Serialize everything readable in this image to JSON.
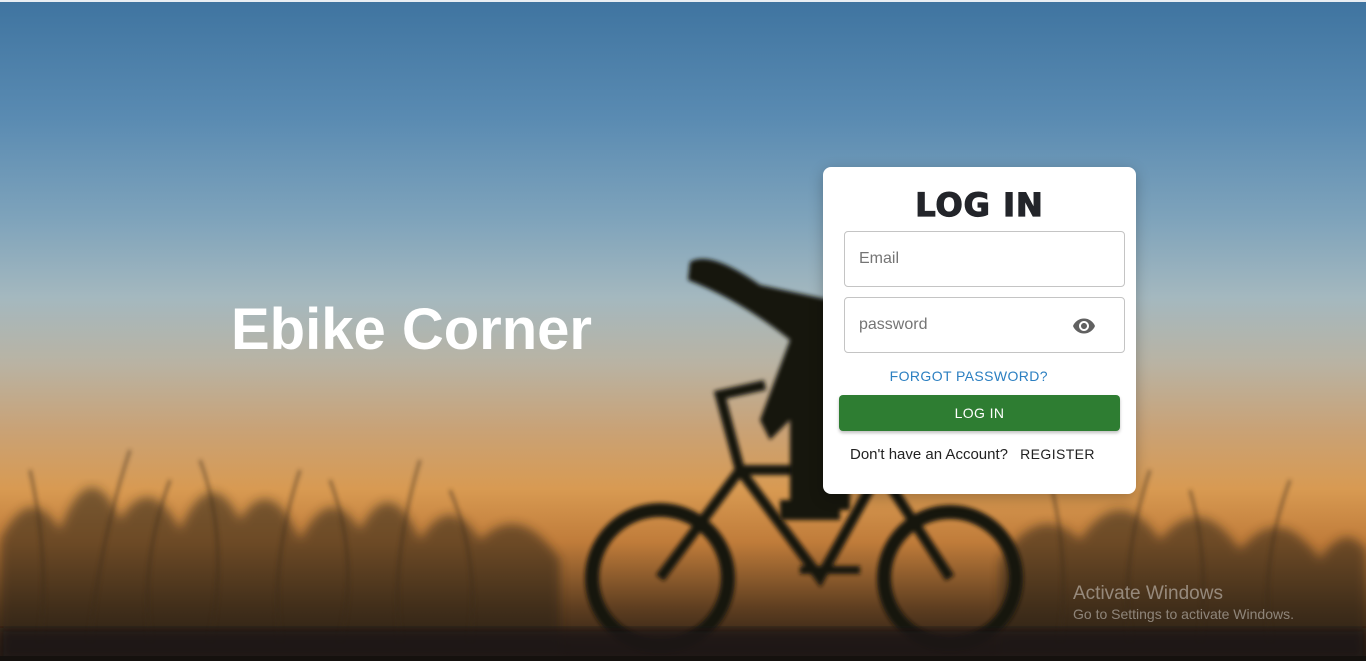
{
  "brand": {
    "title": "Ebike Corner"
  },
  "login_card": {
    "title": "Log In",
    "email": {
      "placeholder": "Email",
      "value": ""
    },
    "password": {
      "placeholder": "password",
      "value": "",
      "toggle_icon": "eye-icon"
    },
    "forgot_password_label": "FORGOT PASSWORD?",
    "login_button_label": "LOG IN",
    "register_prompt": "Don't have an Account?",
    "register_label": "REGISTER"
  },
  "watermark": {
    "title": "Activate Windows",
    "subtitle": "Go to Settings to activate Windows."
  },
  "colors": {
    "login_button": "#2e7d32",
    "forgot_link": "#2b7fc1",
    "card_background": "#ffffff",
    "brand_text": "#ffffff"
  }
}
